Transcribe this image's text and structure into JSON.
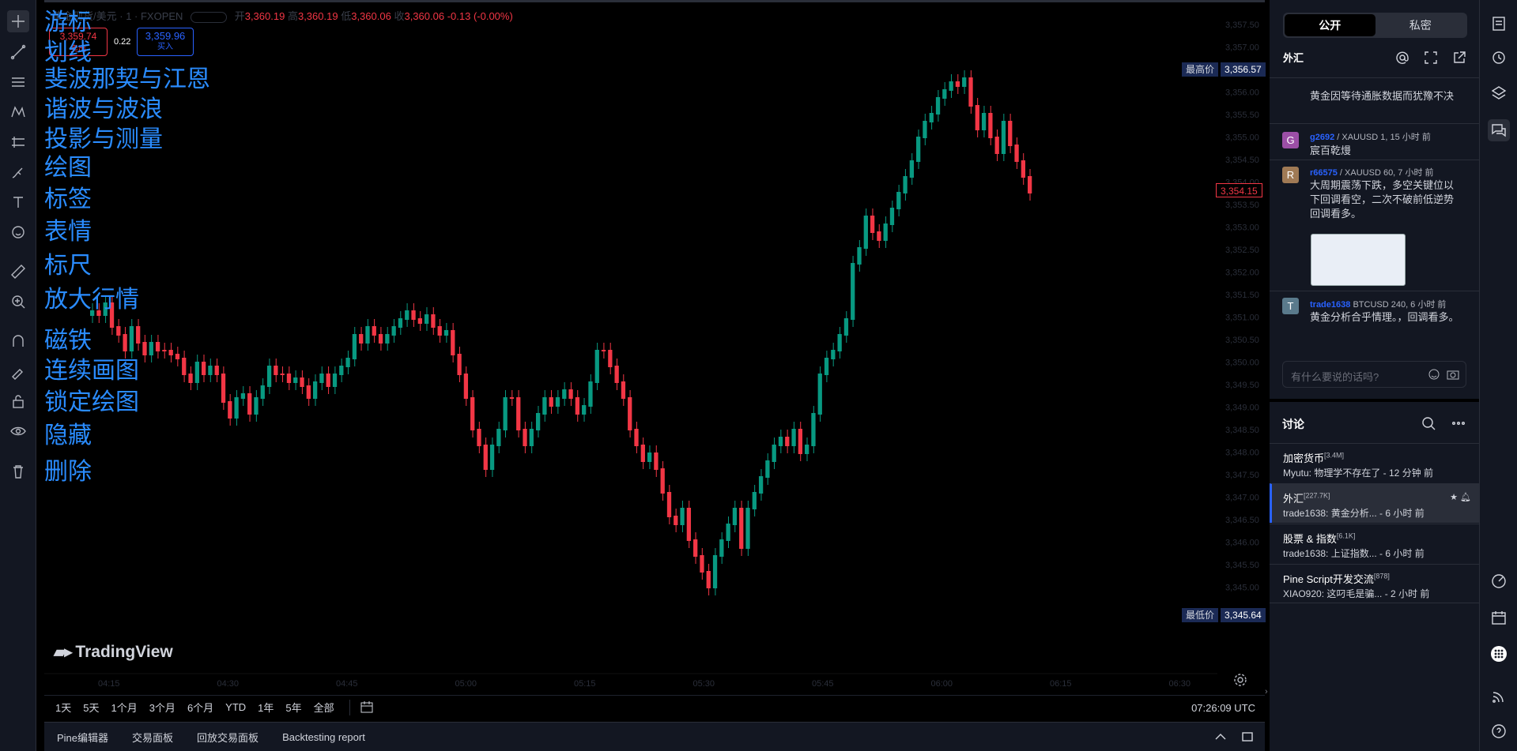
{
  "symbol": {
    "name": "黄金现货/美元",
    "interval": "1",
    "exchange": "FXOPEN",
    "open_label": "开",
    "open": "3,360.19",
    "high_label": "高",
    "high": "3,360.19",
    "low_label": "低",
    "low": "3,360.06",
    "close_label": "收",
    "close": "3,360.06",
    "change": "-0.13 (-0.00%)"
  },
  "trade": {
    "sell_price": "3,359.74",
    "sell_label": "卖出",
    "spread": "0.22",
    "buy_price": "3,359.96",
    "buy_label": "买入"
  },
  "tool_labels": [
    "游标",
    "划线",
    "斐波那契与江恩",
    "谐波与波浪",
    "投影与测量",
    "绘图",
    "标签",
    "表情",
    "标尺",
    "放大行情",
    "磁铁",
    "连续画图",
    "锁定绘图",
    "隐藏",
    "删除"
  ],
  "price_axis": [
    "3,357.50",
    "3,357.00",
    "3,356.50",
    "3,356.00",
    "3,355.50",
    "3,355.00",
    "3,354.50",
    "3,354.00",
    "3,353.50",
    "3,353.00",
    "3,352.50",
    "3,352.00",
    "3,351.50",
    "3,351.00",
    "3,350.50",
    "3,350.00",
    "3,349.50",
    "3,349.00",
    "3,348.50",
    "3,348.00",
    "3,347.50",
    "3,347.00",
    "3,346.50",
    "3,346.00",
    "3,345.50",
    "3,345.00"
  ],
  "time_axis": [
    "04:15",
    "04:30",
    "04:45",
    "05:00",
    "05:15",
    "05:30",
    "05:45",
    "06:00",
    "06:15",
    "06:30"
  ],
  "price_tags": {
    "high_label": "最高价",
    "high": "3,356.57",
    "low_label": "最低价",
    "low": "3,345.64",
    "last": "3,354.15"
  },
  "watermark": "TradingView",
  "ranges": [
    "1天",
    "5天",
    "1个月",
    "3个月",
    "6个月",
    "YTD",
    "1年",
    "5年",
    "全部"
  ],
  "clock": "07:26:09 UTC",
  "panels": [
    "Pine编辑器",
    "交易面板",
    "回放交易面板",
    "Backtesting report"
  ],
  "chat": {
    "tabs": [
      "公开",
      "私密"
    ],
    "room": "外汇",
    "messages": [
      {
        "text": "黄金因等待通胀数据而犹豫不决"
      },
      {
        "initial": "G",
        "color": "#9c4fa6",
        "user": "g2692",
        "meta": "XAUUSD 1, 15 小时 前",
        "text": "宸百乾熳"
      },
      {
        "initial": "R",
        "color": "#a07a55",
        "user": "r66575",
        "meta": "XAUUSD 60, 7 小时 前",
        "text": "大周期震荡下跌，多空关键位以下回调看空，二次不破前低逆势回调看多。"
      },
      {
        "initial": "T",
        "color": "#5a7a8c",
        "user": "trade1638",
        "meta": "BTCUSD 240, 6 小时 前",
        "text": "黄金分析合乎情理。，回调看多。"
      }
    ],
    "input_placeholder": "有什么要说的话吗?"
  },
  "discussions": {
    "title": "讨论",
    "rooms": [
      {
        "name": "加密货币",
        "count": "[3.4M]",
        "last": "Myutu: 物理学不存在了 - 12 分钟 前"
      },
      {
        "name": "外汇",
        "count": "[227.7K]",
        "last": "trade1638: 黄金分析...    - 6 小时 前"
      },
      {
        "name": "股票 & 指数",
        "count": "[6.1K]",
        "last": "trade1638: 上证指数...    - 6 小时 前"
      },
      {
        "name": "Pine Script开发交流",
        "count": "[878]",
        "last": "XIAO920: 这叼毛是骗...    - 2 小时 前"
      }
    ]
  },
  "colors": {
    "up": "#089981",
    "down": "#f23645",
    "accent": "#2962ff",
    "label": "#2a8cff"
  }
}
